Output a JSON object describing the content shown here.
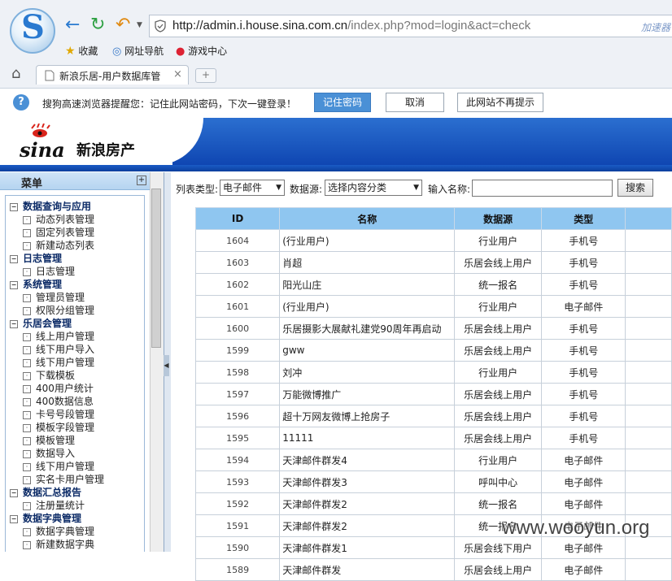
{
  "browser": {
    "url_main": "http://admin.i.house.sina.com.cn",
    "url_rest": "/index.php?mod=login&act=check",
    "accelerate": "加速器",
    "favorites": [
      "收藏",
      "网址导航",
      "游戏中心"
    ],
    "tab_title": "新浪乐居-用户数据库管理",
    "new_tab": "+"
  },
  "password_bar": {
    "message": "搜狗高速浏览器提醒您：记住此网站密码，下次一键登录！",
    "remember": "记住密码",
    "cancel": "取消",
    "never": "此网站不再提示"
  },
  "header": {
    "brand": "sina",
    "sub": "新浪房产"
  },
  "menu": {
    "title": "菜单",
    "items": [
      {
        "t": "数据查询与应用",
        "g": true
      },
      {
        "t": "动态列表管理"
      },
      {
        "t": "固定列表管理"
      },
      {
        "t": "新建动态列表"
      },
      {
        "t": "日志管理",
        "g": true
      },
      {
        "t": "日志管理"
      },
      {
        "t": "系统管理",
        "g": true
      },
      {
        "t": "管理员管理"
      },
      {
        "t": "权限分组管理"
      },
      {
        "t": "乐居会管理",
        "g": true
      },
      {
        "t": "线上用户管理"
      },
      {
        "t": "线下用户导入"
      },
      {
        "t": "线下用户管理"
      },
      {
        "t": "下载模板"
      },
      {
        "t": "400用户统计"
      },
      {
        "t": "400数据信息"
      },
      {
        "t": "卡号号段管理"
      },
      {
        "t": "模板字段管理"
      },
      {
        "t": "模板管理"
      },
      {
        "t": "数据导入"
      },
      {
        "t": "线下用户管理"
      },
      {
        "t": "实名卡用户管理"
      },
      {
        "t": "数据汇总报告",
        "g": true
      },
      {
        "t": "注册量统计"
      },
      {
        "t": "数据字典管理",
        "g": true
      },
      {
        "t": "数据字典管理"
      },
      {
        "t": "新建数据字典"
      }
    ]
  },
  "filters": {
    "list_type_label": "列表类型:",
    "list_type_value": "电子邮件",
    "source_label": "数据源:",
    "source_value": "选择内容分类",
    "name_label": "输入名称:",
    "search": "搜索"
  },
  "table": {
    "headers": [
      "ID",
      "名称",
      "数据源",
      "类型"
    ],
    "rows": [
      [
        "1604",
        "(行业用户)",
        "行业用户",
        "手机号"
      ],
      [
        "1603",
        "肖超",
        "乐居会线上用户",
        "手机号"
      ],
      [
        "1602",
        "阳光山庄",
        "统一报名",
        "手机号"
      ],
      [
        "1601",
        "(行业用户)",
        "行业用户",
        "电子邮件"
      ],
      [
        "1600",
        "乐居摄影大展献礼建党90周年再启动",
        "乐居会线上用户",
        "手机号"
      ],
      [
        "1599",
        "gww",
        "乐居会线上用户",
        "手机号"
      ],
      [
        "1598",
        "刘冲",
        "行业用户",
        "手机号"
      ],
      [
        "1597",
        "万能微博推广",
        "乐居会线上用户",
        "手机号"
      ],
      [
        "1596",
        "超十万网友微博上抢房子",
        "乐居会线上用户",
        "手机号"
      ],
      [
        "1595",
        "11111",
        "乐居会线上用户",
        "手机号"
      ],
      [
        "1594",
        "天津邮件群发4",
        "行业用户",
        "电子邮件"
      ],
      [
        "1593",
        "天津邮件群发3",
        "呼叫中心",
        "电子邮件"
      ],
      [
        "1592",
        "天津邮件群发2",
        "统一报名",
        "电子邮件"
      ],
      [
        "1591",
        "天津邮件群发2",
        "统一报名",
        "电子邮件"
      ],
      [
        "1590",
        "天津邮件群发1",
        "乐居会线下用户",
        "电子邮件"
      ],
      [
        "1589",
        "天津邮件群发",
        "乐居会线上用户",
        "电子邮件"
      ]
    ]
  },
  "watermark": "www.wooyun.org"
}
